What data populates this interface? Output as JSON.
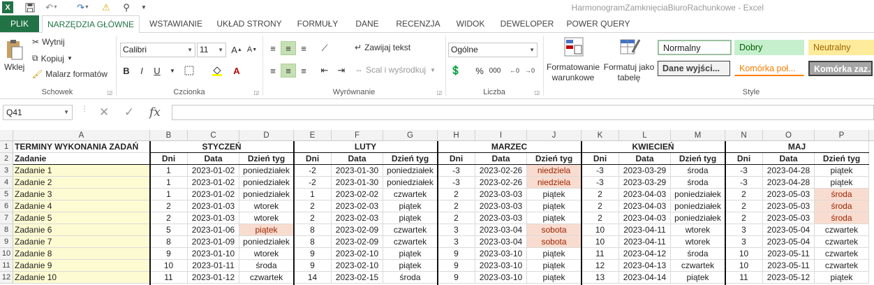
{
  "window": {
    "title": "HarmonogramZamknięciaBiuroRachunkowe - Excel",
    "app_icon": "X"
  },
  "tabs": [
    "PLIK",
    "NARZĘDZIA GŁÓWNE",
    "WSTAWIANIE",
    "UKŁAD STRONY",
    "FORMUŁY",
    "DANE",
    "RECENZJA",
    "WIDOK",
    "DEWELOPER",
    "POWER QUERY"
  ],
  "ribbon": {
    "clipboard": {
      "paste": "Wklej",
      "cut": "Wytnij",
      "copy": "Kopiuj",
      "painter": "Malarz formatów",
      "label": "Schowek"
    },
    "font": {
      "name": "Calibri",
      "size": "11",
      "bold": "B",
      "italic": "I",
      "underline": "U",
      "label": "Czcionka"
    },
    "alignment": {
      "wrap": "Zawijaj tekst",
      "merge": "Scal i wyśrodkuj",
      "label": "Wyrównanie"
    },
    "number": {
      "format": "Ogólne",
      "percent": "%",
      "thousands": "000",
      "label": "Liczba"
    },
    "styles": {
      "conditional": "Formatowanie warunkowe",
      "table": "Formatuj jako tabelę",
      "normal": "Normalny",
      "good": "Dobry",
      "neutral": "Neutralny",
      "output": "Dane wyjści...",
      "linked": "Komórka poł...",
      "check": "Komórka zaz...",
      "label": "Style"
    }
  },
  "formula_bar": {
    "name_box": "Q41",
    "fx": "fx",
    "content": ""
  },
  "columns": [
    "A",
    "B",
    "C",
    "D",
    "E",
    "F",
    "G",
    "H",
    "I",
    "J",
    "K",
    "L",
    "M",
    "N",
    "O",
    "P"
  ],
  "row_numbers": [
    "1",
    "2",
    "3",
    "4",
    "5",
    "6",
    "7",
    "8",
    "9",
    "10",
    "11",
    "12"
  ],
  "sheet": {
    "title": "TERMINY WYKONANIA ZADAŃ",
    "task_header": "Zadanie",
    "months": [
      "STYCZEŃ",
      "LUTY",
      "MARZEC",
      "KWIECIEŃ",
      "MAJ"
    ],
    "sub_headers": [
      "Dni",
      "Data",
      "Dzień tyg"
    ],
    "tasks": [
      "Zadanie 1",
      "Zadanie 2",
      "Zadanie 3",
      "Zadanie 4",
      "Zadanie 5",
      "Zadanie 6",
      "Zadanie 7",
      "Zadanie 8",
      "Zadanie 9",
      "Zadanie 10"
    ],
    "data": [
      [
        [
          "1",
          "2023-01-02",
          "poniedziałek"
        ],
        [
          "-2",
          "2023-01-30",
          "poniedziałek"
        ],
        [
          "-3",
          "2023-02-26",
          "niedziela"
        ],
        [
          "-3",
          "2023-03-29",
          "środa"
        ],
        [
          "-3",
          "2023-04-28",
          "piątek"
        ]
      ],
      [
        [
          "1",
          "2023-01-02",
          "poniedziałek"
        ],
        [
          "-2",
          "2023-01-30",
          "poniedziałek"
        ],
        [
          "-3",
          "2023-02-26",
          "niedziela"
        ],
        [
          "-3",
          "2023-03-29",
          "środa"
        ],
        [
          "-3",
          "2023-04-28",
          "piątek"
        ]
      ],
      [
        [
          "1",
          "2023-01-02",
          "poniedziałek"
        ],
        [
          "1",
          "2023-02-02",
          "czwartek"
        ],
        [
          "2",
          "2023-03-03",
          "piątek"
        ],
        [
          "2",
          "2023-04-03",
          "poniedziałek"
        ],
        [
          "2",
          "2023-05-03",
          "środa"
        ]
      ],
      [
        [
          "2",
          "2023-01-03",
          "wtorek"
        ],
        [
          "2",
          "2023-02-03",
          "piątek"
        ],
        [
          "2",
          "2023-03-03",
          "piątek"
        ],
        [
          "2",
          "2023-04-03",
          "poniedziałek"
        ],
        [
          "2",
          "2023-05-03",
          "środa"
        ]
      ],
      [
        [
          "2",
          "2023-01-03",
          "wtorek"
        ],
        [
          "2",
          "2023-02-03",
          "piątek"
        ],
        [
          "2",
          "2023-03-03",
          "piątek"
        ],
        [
          "2",
          "2023-04-03",
          "poniedziałek"
        ],
        [
          "2",
          "2023-05-03",
          "środa"
        ]
      ],
      [
        [
          "5",
          "2023-01-06",
          "piątek"
        ],
        [
          "8",
          "2023-02-09",
          "czwartek"
        ],
        [
          "3",
          "2023-03-04",
          "sobota"
        ],
        [
          "10",
          "2023-04-11",
          "wtorek"
        ],
        [
          "3",
          "2023-05-04",
          "czwartek"
        ]
      ],
      [
        [
          "8",
          "2023-01-09",
          "poniedziałek"
        ],
        [
          "8",
          "2023-02-09",
          "czwartek"
        ],
        [
          "3",
          "2023-03-04",
          "sobota"
        ],
        [
          "10",
          "2023-04-11",
          "wtorek"
        ],
        [
          "3",
          "2023-05-04",
          "czwartek"
        ]
      ],
      [
        [
          "9",
          "2023-01-10",
          "wtorek"
        ],
        [
          "9",
          "2023-02-10",
          "piątek"
        ],
        [
          "9",
          "2023-03-10",
          "piątek"
        ],
        [
          "11",
          "2023-04-12",
          "środa"
        ],
        [
          "10",
          "2023-05-11",
          "czwartek"
        ]
      ],
      [
        [
          "10",
          "2023-01-11",
          "środa"
        ],
        [
          "9",
          "2023-02-10",
          "piątek"
        ],
        [
          "9",
          "2023-03-10",
          "piątek"
        ],
        [
          "12",
          "2023-04-13",
          "czwartek"
        ],
        [
          "10",
          "2023-05-11",
          "czwartek"
        ]
      ],
      [
        [
          "11",
          "2023-01-12",
          "czwartek"
        ],
        [
          "14",
          "2023-02-15",
          "środa"
        ],
        [
          "9",
          "2023-03-10",
          "piątek"
        ],
        [
          "13",
          "2023-04-14",
          "piątek"
        ],
        [
          "11",
          "2023-05-12",
          "piątek"
        ]
      ]
    ],
    "highlight": [
      [
        2,
        0,
        2
      ],
      [
        2,
        1,
        2
      ],
      [
        0,
        5,
        2
      ],
      [
        2,
        5,
        2
      ],
      [
        2,
        6,
        2
      ],
      [
        4,
        2,
        2
      ],
      [
        4,
        3,
        2
      ],
      [
        4,
        4,
        2
      ]
    ]
  },
  "colors": {
    "excel_green": "#217346",
    "highlight_bg": "#f9dcd0",
    "task_bg": "#fdfbd2"
  }
}
